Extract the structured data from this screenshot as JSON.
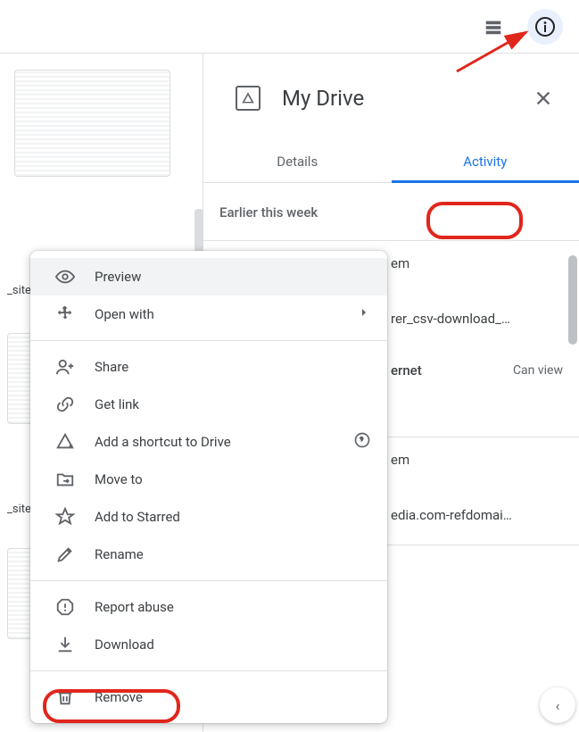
{
  "topbar": {
    "list_icon": "list-view-icon",
    "info_icon": "info-icon"
  },
  "panel": {
    "title": "My Drive",
    "close_icon": "close-icon",
    "tabs": {
      "details": "Details",
      "activity": "Activity"
    }
  },
  "activity": {
    "section_label": "Earlier this week",
    "items": [
      {
        "action_suffix": "em",
        "file": "rer_csv-download_…",
        "shared_with": "ernet",
        "perm": "Can view"
      },
      {
        "action_suffix": "em",
        "file": "edia.com-refdomai…"
      }
    ]
  },
  "left": {
    "labels": [
      "_site",
      "_site"
    ]
  },
  "menu": {
    "preview": "Preview",
    "open_with": "Open with",
    "share": "Share",
    "get_link": "Get link",
    "add_shortcut": "Add a shortcut to Drive",
    "move_to": "Move to",
    "add_starred": "Add to Starred",
    "rename": "Rename",
    "report_abuse": "Report abuse",
    "download": "Download",
    "remove": "Remove"
  },
  "fab": {
    "label": "‹"
  }
}
